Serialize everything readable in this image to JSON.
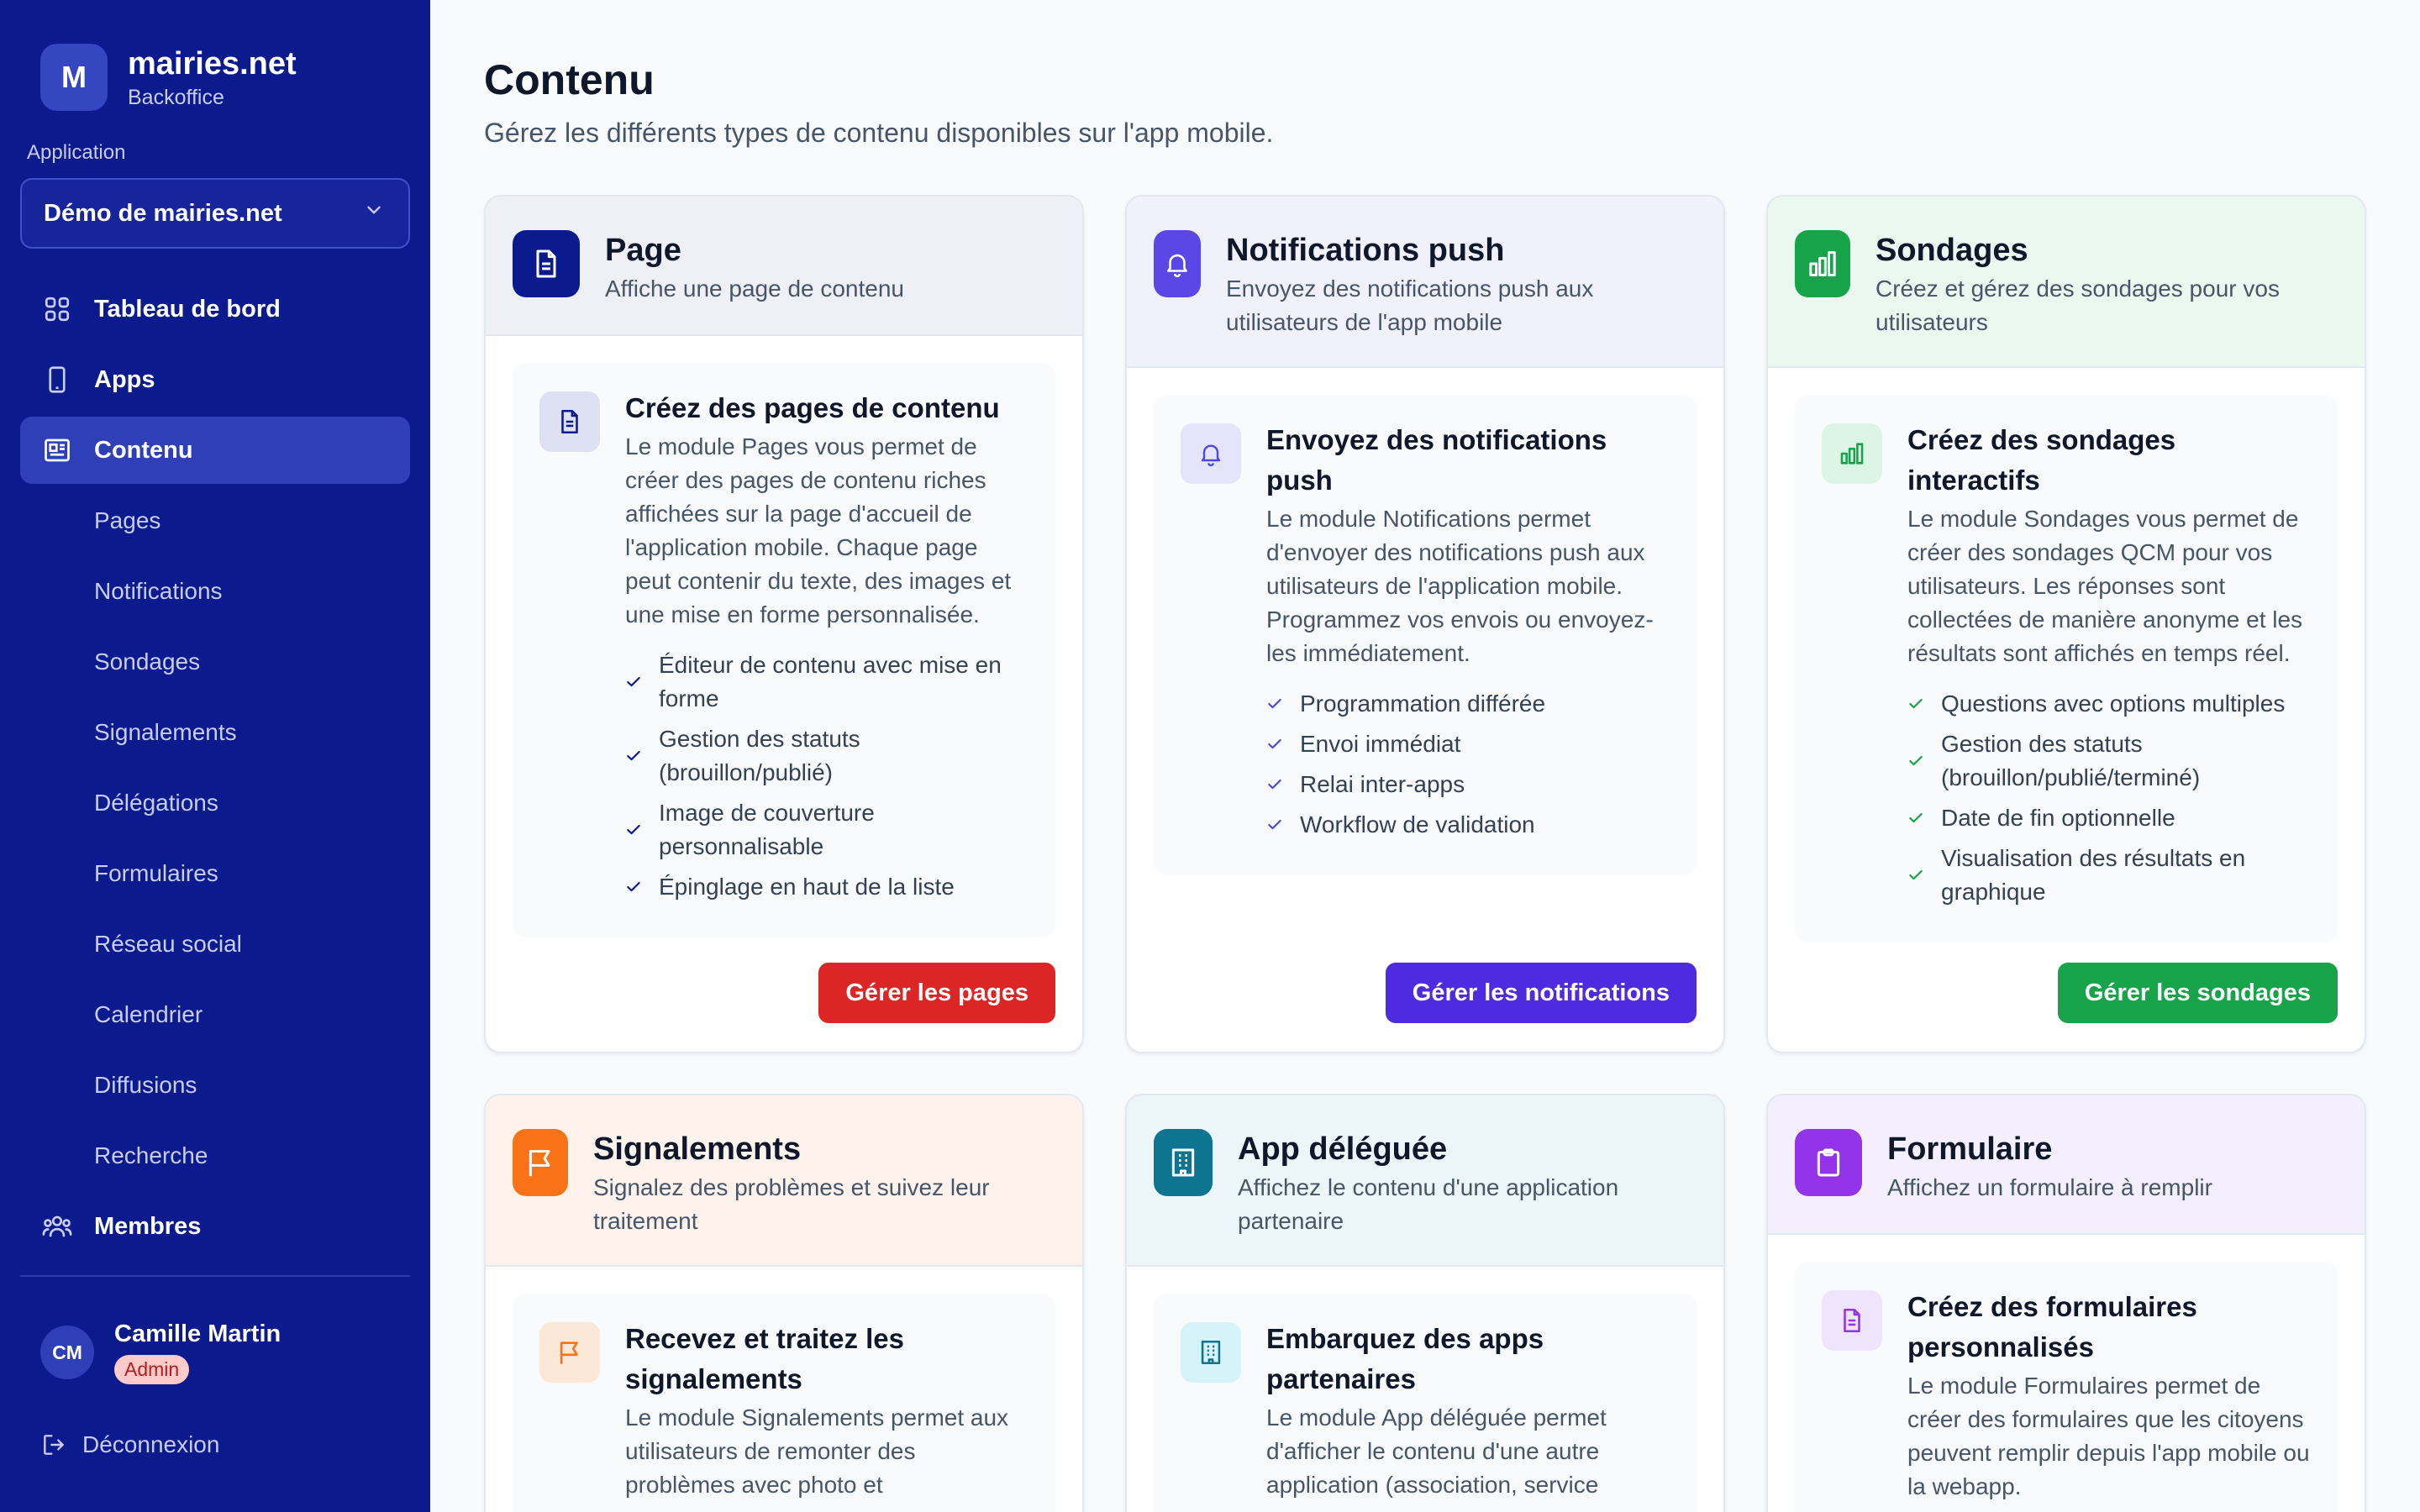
{
  "sidebar": {
    "brand": {
      "logo": "M",
      "name": "mairies.net",
      "subtitle": "Backoffice"
    },
    "app_label": "Application",
    "app_select": "Démo de mairies.net",
    "items": [
      {
        "label": "Tableau de bord",
        "icon": "grid-icon"
      },
      {
        "label": "Apps",
        "icon": "phone-icon"
      },
      {
        "label": "Contenu",
        "icon": "newspaper-icon",
        "active": true
      }
    ],
    "subitems": [
      "Pages",
      "Notifications",
      "Sondages",
      "Signalements",
      "Délégations",
      "Formulaires",
      "Réseau social",
      "Calendrier",
      "Diffusions",
      "Recherche"
    ],
    "members": {
      "label": "Membres",
      "icon": "users-icon"
    },
    "user": {
      "initials": "CM",
      "name": "Camille Martin",
      "role": "Admin"
    },
    "logout": "Déconnexion"
  },
  "main": {
    "title": "Contenu",
    "subtitle": "Gérez les différents types de contenu disponibles sur l'app mobile.",
    "cards": [
      {
        "title": "Page",
        "desc": "Affiche une page de contenu",
        "feature_title": "Créez des pages de contenu",
        "feature_text": "Le module Pages vous permet de créer des pages de contenu riches affichées sur la page d'accueil de l'application mobile. Chaque page peut contenir du texte, des images et une mise en forme personnalisée.",
        "checks": [
          "Éditeur de contenu avec mise en forme",
          "Gestion des statuts (brouillon/publié)",
          "Image de couverture personnalisable",
          "Épinglage en haut de la liste"
        ],
        "button": "Gérer les pages",
        "colors": {
          "icon": "#0b1a8c",
          "button": "#dc2626",
          "head": "#eef0f6"
        }
      },
      {
        "title": "Notifications push",
        "desc": "Envoyez des notifications push aux utilisateurs de l'app mobile",
        "feature_title": "Envoyez des notifications push",
        "feature_text": "Le module Notifications permet d'envoyer des notifications push aux utilisateurs de l'application mobile. Programmez vos envois ou envoyez-les immédiatement.",
        "checks": [
          "Programmation différée",
          "Envoi immédiat",
          "Relai inter-apps",
          "Workflow de validation"
        ],
        "button": "Gérer les notifications",
        "colors": {
          "icon": "#4f46e5",
          "button": "#4f2be0",
          "head": "#f0f1fb"
        }
      },
      {
        "title": "Sondages",
        "desc": "Créez et gérez des sondages pour vos utilisateurs",
        "feature_title": "Créez des sondages interactifs",
        "feature_text": "Le module Sondages vous permet de créer des sondages QCM pour vos utilisateurs. Les réponses sont collectées de manière anonyme et les résultats sont affichés en temps réel.",
        "checks": [
          "Questions avec options multiples",
          "Gestion des statuts (brouillon/publié/terminé)",
          "Date de fin optionnelle",
          "Visualisation des résultats en graphique"
        ],
        "button": "Gérer les sondages",
        "colors": {
          "icon": "#16a34a",
          "button": "#16a34a",
          "head": "#ebf8f0"
        }
      },
      {
        "title": "Signalements",
        "desc": "Signalez des problèmes et suivez leur traitement",
        "feature_title": "Recevez et traitez les signalements",
        "feature_text": "Le module Signalements permet aux utilisateurs de remonter des problèmes avec photo et",
        "colors": {
          "icon": "#f97316",
          "head": "#fdf3ec"
        }
      },
      {
        "title": "App déléguée",
        "desc": "Affichez le contenu d'une application partenaire",
        "feature_title": "Embarquez des apps partenaires",
        "feature_text": "Le module App déléguée permet d'afficher le contenu d'une autre application (association, service",
        "colors": {
          "icon": "#0e7490",
          "head": "#ecf5f7"
        }
      },
      {
        "title": "Formulaire",
        "desc": "Affichez un formulaire à remplir",
        "feature_title": "Créez des formulaires personnalisés",
        "feature_text": "Le module Formulaires permet de créer des formulaires que les citoyens peuvent remplir depuis l'app mobile ou la webapp.",
        "colors": {
          "icon": "#9333ea",
          "head": "#f4effc"
        }
      }
    ]
  }
}
